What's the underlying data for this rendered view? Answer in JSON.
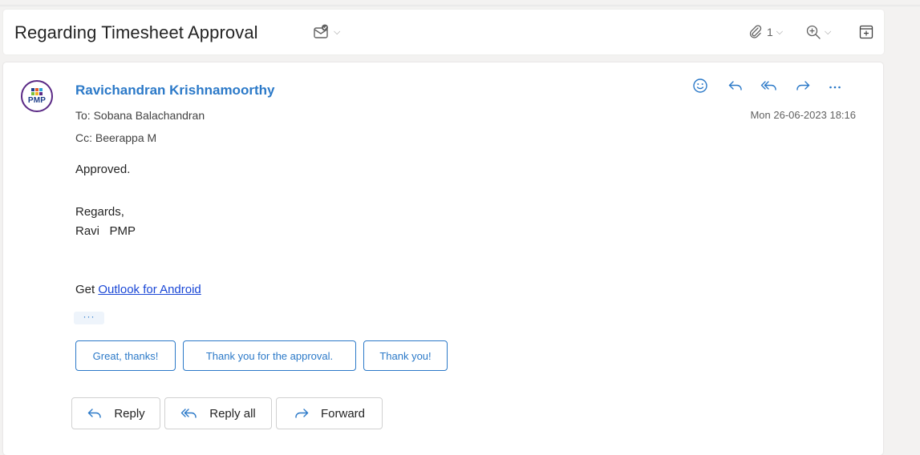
{
  "header": {
    "subject": "Regarding Timesheet Approval",
    "attachments_count": "1"
  },
  "message": {
    "avatar_text": "PMP",
    "sender": "Ravichandran Krishnamoorthy",
    "to": "To: Sobana Balachandran",
    "cc": "Cc: Beerappa M",
    "date": "Mon 26-06-2023 18:16",
    "body": {
      "line1": "Approved.",
      "line2": "Regards,",
      "line3": "Ravi   PMP",
      "get_prefix": "Get ",
      "link": "Outlook for Android"
    },
    "more": "···"
  },
  "quick_replies": [
    "Great, thanks!",
    "Thank you for the approval.",
    "Thank you!"
  ],
  "reply_buttons": {
    "reply": "Reply",
    "reply_all": "Reply all",
    "forward": "Forward"
  },
  "colors": {
    "accent": "#2b79c8",
    "link": "#1a47d6",
    "avatar_ring": "#5b2a86"
  }
}
